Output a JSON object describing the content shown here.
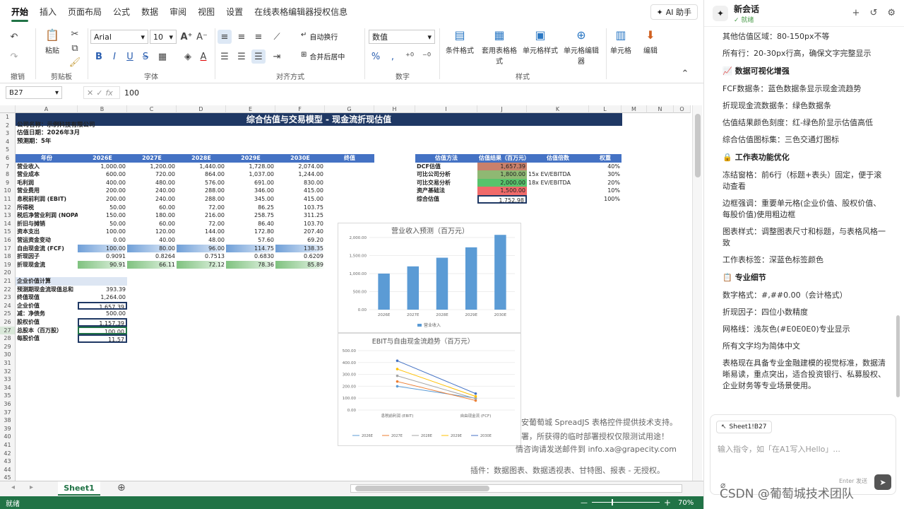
{
  "tabs": [
    "开始",
    "插入",
    "页面布局",
    "公式",
    "数据",
    "审阅",
    "视图",
    "设置",
    "在线表格编辑器授权信息"
  ],
  "ai_button": "AI 助手",
  "ribbon": {
    "groups": {
      "undo": "撤销",
      "clipboard": "剪贴板",
      "font": "字体",
      "align": "对齐方式",
      "number": "数字",
      "style": "样式"
    },
    "paste": "粘贴",
    "font_name": "Arial",
    "font_size": "10",
    "wrap": "自动换行",
    "merge": "合并后居中",
    "num_format": "数值",
    "cond_format": "条件格式",
    "table_format": "套用表格格式",
    "cell_style": "单元格样式",
    "cell_editor": "单元格编辑器",
    "cells": "单元格",
    "edit": "编辑"
  },
  "formula_bar": {
    "name_box": "B27",
    "fx": "fx",
    "value": "100"
  },
  "sheet": {
    "title": "综合估值与交易模型 - 现金流折现估值",
    "col_letters": [
      "A",
      "B",
      "C",
      "D",
      "E",
      "F",
      "G",
      "H",
      "I",
      "J",
      "K",
      "L",
      "M",
      "N",
      "O"
    ],
    "rows": [
      "1",
      "2",
      "3",
      "4",
      "5",
      "6",
      "7",
      "8",
      "9",
      "10",
      "11",
      "12",
      "13",
      "14",
      "15",
      "16",
      "17",
      "18",
      "19",
      "20",
      "21",
      "22",
      "23",
      "24",
      "25",
      "26",
      "27",
      "28",
      "29",
      "30",
      "31",
      "32",
      "33",
      "34",
      "35",
      "36",
      "37",
      "38",
      "39",
      "40",
      "41",
      "42",
      "43",
      "44",
      "45"
    ],
    "company": "公司名称：示例科技有限公司",
    "date": "估值日期：2026年3月",
    "period": "预测期：5年",
    "table_headers": [
      "年份",
      "2026E",
      "2027E",
      "2028E",
      "2029E",
      "2030E",
      "终值"
    ],
    "table_rows": [
      [
        "营业收入",
        "1,000.00",
        "1,200.00",
        "1,440.00",
        "1,728.00",
        "2,074.00"
      ],
      [
        "营业成本",
        "600.00",
        "720.00",
        "864.00",
        "1,037.00",
        "1,244.00"
      ],
      [
        "毛利润",
        "400.00",
        "480.00",
        "576.00",
        "691.00",
        "830.00"
      ],
      [
        "营业费用",
        "200.00",
        "240.00",
        "288.00",
        "346.00",
        "415.00"
      ],
      [
        "息税前利润 (EBIT)",
        "200.00",
        "240.00",
        "288.00",
        "345.00",
        "415.00"
      ],
      [
        "所得税",
        "50.00",
        "60.00",
        "72.00",
        "86.25",
        "103.75"
      ],
      [
        "税后净营业利润 (NOPAT)",
        "150.00",
        "180.00",
        "216.00",
        "258.75",
        "311.25"
      ],
      [
        "折旧与摊销",
        "50.00",
        "60.00",
        "72.00",
        "86.40",
        "103.70"
      ],
      [
        "资本支出",
        "100.00",
        "120.00",
        "144.00",
        "172.80",
        "207.40"
      ],
      [
        "营运资金变动",
        "0.00",
        "40.00",
        "48.00",
        "57.60",
        "69.20"
      ],
      [
        "自由现金流 (FCF)",
        "100.00",
        "80.00",
        "96.00",
        "114.75",
        "138.35"
      ],
      [
        "折现因子",
        "0.9091",
        "0.8264",
        "0.7513",
        "0.6830",
        "0.6209"
      ],
      [
        "折现现金流",
        "90.91",
        "66.11",
        "72.12",
        "78.36",
        "85.89"
      ]
    ],
    "ev_title": "企业价值计算",
    "ev_rows": [
      [
        "预测期现金流现值总和",
        "393.39"
      ],
      [
        "终值现值",
        "1,264.00"
      ],
      [
        "企业价值",
        "1,657.39"
      ],
      [
        "减：净债务",
        "500.00"
      ],
      [
        "股权价值",
        "1,157.39"
      ],
      [
        "总股本（百万股）",
        "100.00"
      ],
      [
        "每股价值",
        "11.57"
      ]
    ],
    "val_headers": [
      "估值方法",
      "估值结果（百万元）",
      "估值倍数",
      "权重"
    ],
    "val_rows": [
      [
        "DCF估值",
        "1,657.39",
        "",
        "40%"
      ],
      [
        "可比公司分析",
        "1,800.00",
        "15x EV/EBITDA",
        "30%"
      ],
      [
        "可比交易分析",
        "2,000.00",
        "18x EV/EBITDA",
        "20%"
      ],
      [
        "资产基础法",
        "1,500.00",
        "",
        "10%"
      ],
      [
        "综合估值",
        "1,752.98",
        "",
        "100%"
      ]
    ]
  },
  "chart1": {
    "title": "营业收入预测（百万元）",
    "y_ticks": [
      "2,000.00",
      "1,500.00",
      "1,000.00",
      "500.00",
      "0.00"
    ],
    "legend": "营业收入"
  },
  "chart2": {
    "title": "EBIT与自由现金流趋势（百万元）",
    "y_ticks": [
      "500.00",
      "400.00",
      "300.00",
      "200.00",
      "100.00",
      "0.00"
    ],
    "categories": [
      "息税前利润 (EBIT)",
      "自由现金流 (FCF)"
    ],
    "legend": [
      "2026E",
      "2027E",
      "2028E",
      "2029E",
      "2030E"
    ]
  },
  "chart_data": [
    {
      "type": "bar",
      "title": "营业收入预测（百万元）",
      "categories": [
        "2026E",
        "2027E",
        "2028E",
        "2029E",
        "2030E"
      ],
      "values": [
        1000,
        1200,
        1440,
        1728,
        2074
      ],
      "ylim": [
        0,
        2000
      ],
      "series": [
        {
          "name": "营业收入",
          "values": [
            1000,
            1200,
            1440,
            1728,
            2074
          ]
        }
      ],
      "color": "#5b9bd5"
    },
    {
      "type": "line",
      "title": "EBIT与自由现金流趋势（百万元）",
      "categories": [
        "息税前利润 (EBIT)",
        "自由现金流 (FCF)"
      ],
      "ylim": [
        0,
        500
      ],
      "series": [
        {
          "name": "2026E",
          "values": [
            200,
            100
          ]
        },
        {
          "name": "2027E",
          "values": [
            240,
            80
          ]
        },
        {
          "name": "2028E",
          "values": [
            288,
            96
          ]
        },
        {
          "name": "2029E",
          "values": [
            345,
            114.75
          ]
        },
        {
          "name": "2030E",
          "values": [
            415,
            138.35
          ]
        }
      ],
      "colors": [
        "#5b9bd5",
        "#ed7d31",
        "#a5a5a5",
        "#ffc000",
        "#4472c4"
      ]
    }
  ],
  "watermark": [
    "安葡萄城 SpreadJS 表格控件提供技术支持。",
    "署，所获得的临时部署授权仅限测试用途！",
    "情咨询请发送邮件到 info.xa@grapecity.com",
    "插件：数据图表、数据透视表、甘特图、报表 - 无授权。"
  ],
  "sheet_tab": "Sheet1",
  "status": "就绪",
  "zoom": "70%",
  "panel": {
    "title": "新会话",
    "subtitle": "就绪",
    "lines": [
      {
        "t": "line",
        "v": "其他估值区域：80-150px不等"
      },
      {
        "t": "line",
        "v": "所有行：20-30px行高，确保文字完整显示"
      },
      {
        "t": "sec",
        "v": "数据可视化增强"
      },
      {
        "t": "line",
        "v": "FCF数据条：蓝色数据条显示现金流趋势"
      },
      {
        "t": "line",
        "v": "折现现金流数据条：绿色数据条"
      },
      {
        "t": "line",
        "v": "估值结果颜色刻度：红-绿色阶显示估值高低"
      },
      {
        "t": "line",
        "v": "综合估值图标集：三色交通灯图标"
      },
      {
        "t": "sec",
        "v": "工作表功能优化"
      },
      {
        "t": "line",
        "v": "冻结窗格：前6行（标题+表头）固定，便于滚动查看"
      },
      {
        "t": "line",
        "v": "边框强调：重要单元格(企业价值、股权价值、每股价值)使用粗边框"
      },
      {
        "t": "line",
        "v": "图表样式：调整图表尺寸和标题，与表格风格一致"
      },
      {
        "t": "line",
        "v": "工作表标签：深蓝色标签颜色"
      },
      {
        "t": "sec",
        "v": "专业细节"
      },
      {
        "t": "line",
        "v": "数字格式：#,##0.00（会计格式）"
      },
      {
        "t": "line",
        "v": "折现因子：四位小数精度"
      },
      {
        "t": "line",
        "v": "网格线：浅灰色(#E0E0E0)专业显示"
      },
      {
        "t": "line",
        "v": "所有文字均为简体中文"
      },
      {
        "t": "line",
        "v": "表格现在具备专业金融建模的视觉标准，数据清晰易读，重点突出，适合投资银行、私募股权、企业财务等专业场景使用。"
      }
    ],
    "context_chip": "Sheet1!B27",
    "placeholder": "输入指令，如「在A1写入Hello」...",
    "send_hint": "Enter 发送",
    "csdn": "CSDN @葡萄城技术团队"
  }
}
